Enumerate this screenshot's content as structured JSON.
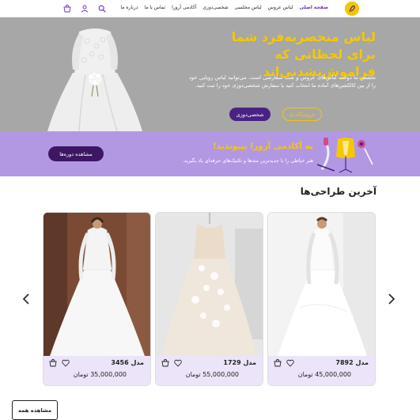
{
  "nav": {
    "menu": [
      "صفحه اصلی",
      "لباس عروس",
      "لباس مجلسی",
      "شخصی‌دوزی",
      "آکادمی آرورا",
      "تماس با ما",
      "درباره ما"
    ]
  },
  "hero": {
    "title_line1": "لباس منحصربه‌فرد شما",
    "title_line2": "برای لحظاتی که فراموش‌نشدنی‌اند",
    "description": "تخصص ما دوخت لباس‌های عروس و شب سفارشی است. می‌توانید لباس رویایی خود را از بین کالکشن‌های آماده ما انتخاب کنید یا سفارش شخصی‌دوزی خود را ثبت کنید.",
    "btn_shop": "فروشگاه ما",
    "btn_custom": "شخصی‌دوزی"
  },
  "academy": {
    "title": "به آکادمی آرورا بپیوندید!",
    "subtitle": "هنر خیاطی را با جدیدترین متدها و تکنیک‌های حرفه‌ای یاد بگیرید.",
    "btn_courses": "مشاهده دوره‌ها"
  },
  "designs": {
    "title": "آخرین طراحی‌ها",
    "cards": [
      {
        "model": "مدل 7892",
        "price": "45,000,000 تومان"
      },
      {
        "model": "مدل 1729",
        "price": "55,000,000 تومان"
      },
      {
        "model": "مدل 3456",
        "price": "35,000,000 تومان"
      }
    ],
    "btn_all": "مشاهده همه"
  },
  "colors": {
    "accent_yellow": "#f5c800",
    "purple_dark": "#4a2284",
    "lavender": "#b298e2",
    "card_info_bg": "#ece4f8"
  },
  "icons": [
    "logo-icon",
    "search-icon",
    "user-icon",
    "cart-icon",
    "heart-icon",
    "cart-add-icon",
    "chevron-left-icon",
    "chevron-right-icon"
  ]
}
